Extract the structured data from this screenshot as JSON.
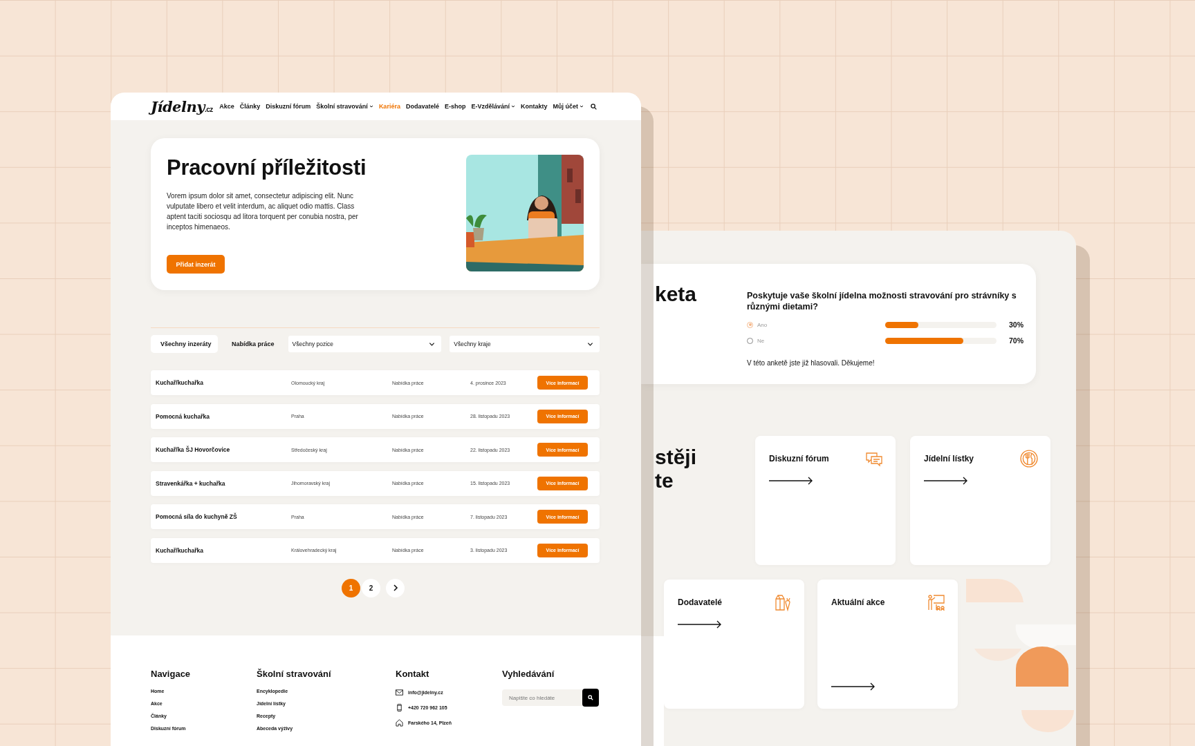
{
  "logo": {
    "name": "Jídelny",
    "suffix": ".cz"
  },
  "nav": [
    {
      "label": "Akce",
      "selected": false,
      "has_menu": false
    },
    {
      "label": "Články",
      "selected": false,
      "has_menu": false
    },
    {
      "label": "Diskuzní fórum",
      "selected": false,
      "has_menu": false
    },
    {
      "label": "Školní stravování",
      "selected": false,
      "has_menu": true
    },
    {
      "label": "Kariéra",
      "selected": true,
      "has_menu": false
    },
    {
      "label": "Dodavatelé",
      "selected": false,
      "has_menu": false
    },
    {
      "label": "E-shop",
      "selected": false,
      "has_menu": false
    },
    {
      "label": "E-Vzdělávání",
      "selected": false,
      "has_menu": true
    },
    {
      "label": "Kontakty",
      "selected": false,
      "has_menu": false
    },
    {
      "label": "Můj účet",
      "selected": false,
      "has_menu": true
    }
  ],
  "hero": {
    "title": "Pracovní příležitosti",
    "text": "Vorem ipsum dolor sit amet, consectetur adipiscing elit. Nunc vulputate libero et velit interdum, ac aliquet odio mattis. Class aptent taciti sociosqu ad litora torquent per conubia nostra, per inceptos himenaeos.",
    "button": "Přidat inzerát"
  },
  "filters": {
    "tabs": [
      {
        "label": "Všechny inzeráty",
        "selected": true
      },
      {
        "label": "Nabídka práce",
        "selected": false
      }
    ],
    "dropdowns": [
      {
        "value": "Všechny pozice"
      },
      {
        "value": "Všechny kraje"
      }
    ]
  },
  "jobs": [
    {
      "title": "Kuchař/kuchařka",
      "region": "Olomoucký kraj",
      "type": "Nabídka práce",
      "date": "4. prosince 2023",
      "button": "Více informací"
    },
    {
      "title": "Pomocná kuchařka",
      "region": "Praha",
      "type": "Nabídka práce",
      "date": "28. listopadu 2023",
      "button": "Více informací"
    },
    {
      "title": "Kuchař/ka ŠJ Hovorčovice",
      "region": "Středočeský kraj",
      "type": "Nabídka práce",
      "date": "22. listopadu 2023",
      "button": "Více informací"
    },
    {
      "title": "Stravenkářka + kuchařka",
      "region": "Jihomoravský kraj",
      "type": "Nabídka práce",
      "date": "15. listopadu 2023",
      "button": "Více informací"
    },
    {
      "title": "Pomocná síla do kuchyně ZŠ",
      "region": "Praha",
      "type": "Nabídka práce",
      "date": "7. listopadu 2023",
      "button": "Více informací"
    },
    {
      "title": "Kuchař/kuchařka",
      "region": "Královehradecký kraj",
      "type": "Nabídka práce",
      "date": "3. listopadu 2023",
      "button": "Více informací"
    }
  ],
  "pagination": {
    "pages": [
      {
        "label": "1",
        "selected": true
      },
      {
        "label": "2",
        "selected": false
      }
    ]
  },
  "footer": {
    "columns": [
      {
        "heading": "Navigace",
        "kind": "links",
        "items": [
          {
            "label": "Home"
          },
          {
            "label": "Akce"
          },
          {
            "label": "Články"
          },
          {
            "label": "Diskuzní fórum"
          }
        ]
      },
      {
        "heading": "Školní stravování",
        "kind": "links",
        "items": [
          {
            "label": "Encyklopedie"
          },
          {
            "label": "Jídelní lístky"
          },
          {
            "label": "Recepty"
          },
          {
            "label": "Abeceda výživy"
          }
        ]
      },
      {
        "heading": "Kontakt",
        "kind": "contacts",
        "items": [
          {
            "label": "info@jidelny.cz",
            "kind": "email"
          },
          {
            "label": "+420 720 962 105",
            "kind": "phone"
          },
          {
            "label": "Farského 14, Plzeň",
            "kind": "address"
          }
        ]
      },
      {
        "heading": "Vyhledávání",
        "kind": "search",
        "placeholder": "Napište co hledáte"
      }
    ]
  },
  "poll": {
    "heading": "keta",
    "question": "Poskytuje vaše školní jídelna možnosti stravování pro strávníky s různými dietami?",
    "options": [
      {
        "label": "Ano",
        "selected": true,
        "level": 0.3,
        "reading": "30%"
      },
      {
        "label": "Ne",
        "selected": false,
        "level": 0.7,
        "reading": "70%"
      }
    ],
    "note": "V této anketě jste již hlasovali. Děkujeme!"
  },
  "shortcuts": {
    "heading_lines": [
      "stěji",
      "te"
    ],
    "cards": [
      {
        "title": "Diskuzní fórum",
        "kind": "forum"
      },
      {
        "title": "Jídelní lístky",
        "kind": "menu"
      },
      {
        "title": "Dodavatelé",
        "kind": "suppliers"
      },
      {
        "title": "Aktuální akce",
        "kind": "events"
      }
    ]
  }
}
